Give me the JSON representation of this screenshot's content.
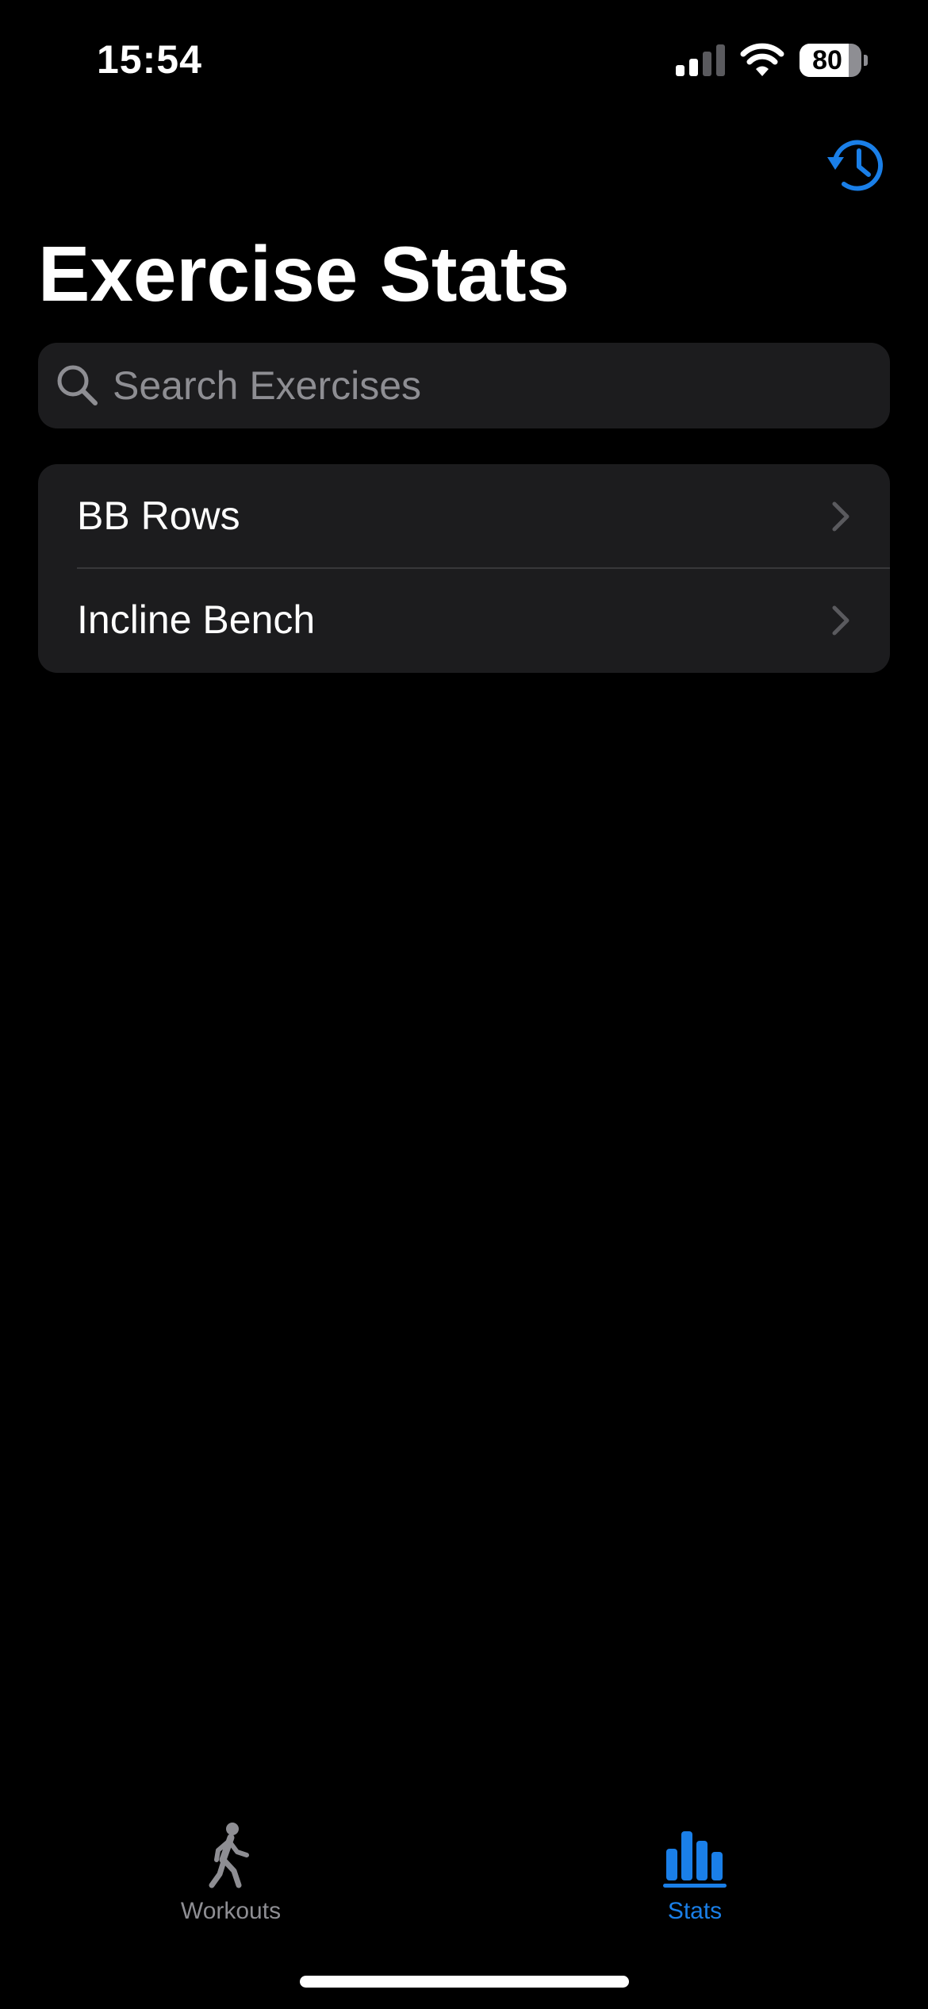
{
  "status_bar": {
    "time": "15:54",
    "battery_percent": 80,
    "battery_label": "80",
    "signal_bars_active": 2,
    "signal_bars_total": 4
  },
  "header": {
    "history_icon": "clock-arrow-circlepath-icon",
    "title": "Exercise Stats"
  },
  "search": {
    "placeholder": "Search Exercises",
    "value": ""
  },
  "exercises": [
    {
      "label": "BB Rows"
    },
    {
      "label": "Incline Bench"
    }
  ],
  "tab_bar": {
    "tabs": [
      {
        "label": "Workouts",
        "icon": "figure-walk-icon",
        "selected": false
      },
      {
        "label": "Stats",
        "icon": "bar-chart-icon",
        "selected": true
      }
    ]
  },
  "colors": {
    "accent": "#1a7fe8",
    "background": "#000000",
    "surface": "#1c1c1e",
    "inactive": "#8e8e93"
  }
}
